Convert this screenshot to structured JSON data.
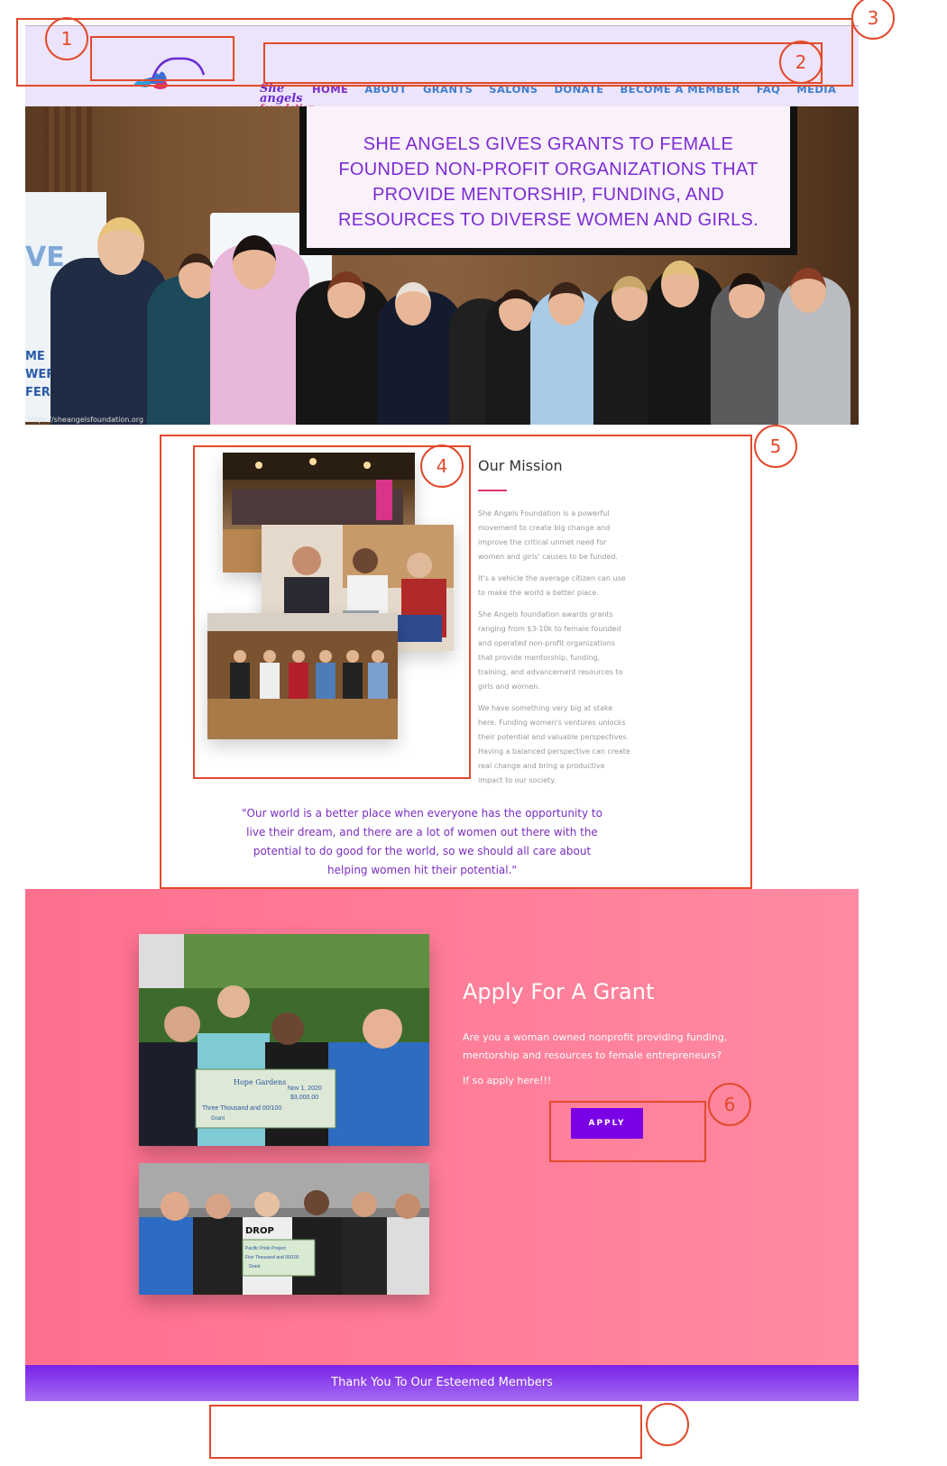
{
  "header": {
    "logo_line1": "She",
    "logo_line2": "angels",
    "logo_line3": "foundation",
    "nav": [
      "HOME",
      "ABOUT",
      "GRANTS",
      "SALONS",
      "DONATE",
      "BECOME A MEMBER",
      "FAQ",
      "MEDIA"
    ],
    "active": "HOME"
  },
  "hero": {
    "screen_text": "SHE ANGELS GIVES GRANTS TO FEMALE FOUNDED NON-PROFIT ORGANIZATIONS THAT PROVIDE MENTORSHIP, FUNDING, AND RESOURCES TO DIVERSE WOMEN AND GIRLS.",
    "banner_letters": [
      "VE",
      "ME",
      "WER",
      "FERE"
    ],
    "url_caption": "https://sheangelsfoundation.org"
  },
  "mission": {
    "title": "Our Mission",
    "paragraphs": [
      "She Angels Foundation is a powerful movement to create big change and improve the critical unmet need for women and girls' causes to be funded.",
      "It's a vehicle the average citizen can use to make the world a better place.",
      "She Angels foundation awards grants ranging from $3-10k to female founded and operated non-profit organizations that provide mentorship, funding, training, and advancement resources to girls and women.",
      "We have something very big at stake here. Funding women's ventures unlocks their potential and valuable perspectives. Having a balanced perspective can create real change and bring a productive impact to our society."
    ],
    "quote": "\"Our world is a better place when everyone has the opportunity to live their dream, and there are a lot of women out there with the potential to do good for the world, so we should all care about helping women hit their potential.\""
  },
  "grant": {
    "title": "Apply For A Grant",
    "text": "Are you a woman owned nonprofit providing funding, mentorship and resources to female entrepreneurs?",
    "text2": "If so apply here!!!",
    "button": "APPLY",
    "check1_payee": "Hope Gardens",
    "check1_date": "Nov 1, 2020",
    "check1_amount": "$3,000.00",
    "check1_words": "Three Thousand and 00/100",
    "check1_memo": "Grant",
    "check2_payee": "Pacific Pride Project",
    "check2_words": "Five Thousand and 00/100",
    "check2_memo": "Grant",
    "sign_text": "DROP"
  },
  "members_bar": "Thank You To Our Esteemed Members",
  "annotations": [
    "1",
    "2",
    "3",
    "4",
    "5",
    "6"
  ],
  "colors": {
    "header_bg": "#ece4fb",
    "nav": "#3f7fcf",
    "nav_active": "#7a2ec1",
    "accent_purple": "#7b2dd3",
    "grant_bg": "#ff7f97",
    "apply_button": "#7a00e6",
    "annotation": "#e24a2c"
  }
}
